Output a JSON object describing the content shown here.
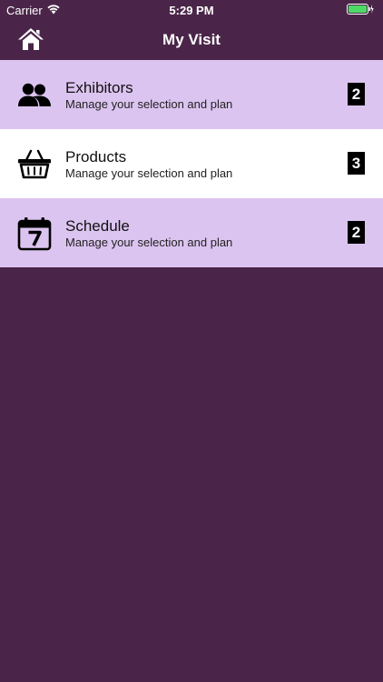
{
  "status_bar": {
    "carrier": "Carrier",
    "time": "5:29 PM",
    "wifi_icon": "wifi-icon",
    "battery_icon": "battery-icon"
  },
  "nav": {
    "title": "My Visit",
    "home_icon": "home-icon"
  },
  "menu": [
    {
      "label": "Exhibitors",
      "subtitle": "Manage your selection and plan",
      "count": "2",
      "icon": "people-icon"
    },
    {
      "label": "Products",
      "subtitle": "Manage your selection and plan",
      "count": "3",
      "icon": "basket-icon"
    },
    {
      "label": "Schedule",
      "subtitle": "Manage your selection and plan",
      "count": "2",
      "icon": "calendar-icon"
    }
  ],
  "colors": {
    "background": "#4a2549",
    "row_shaded": "#dcc4f0",
    "row_plain": "#ffffff",
    "battery": "#4cd964"
  }
}
